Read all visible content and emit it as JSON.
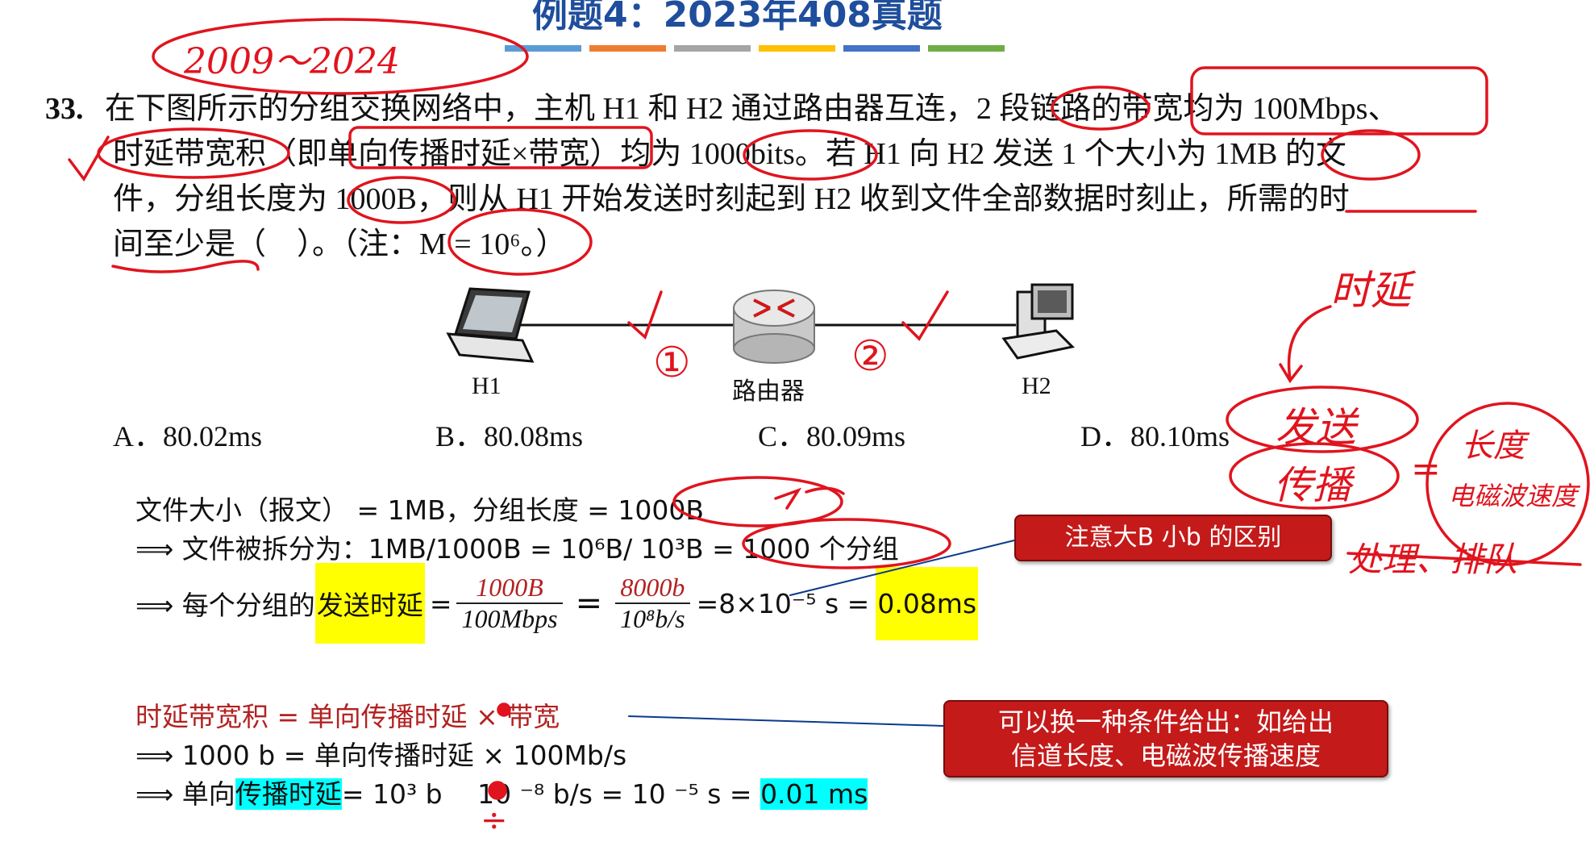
{
  "header": {
    "title": "例题4：2023年408真题",
    "bar_colors": [
      "#5b9bd5",
      "#ed7d31",
      "#a5a5a5",
      "#ffc000",
      "#4472c4",
      "#70ad47"
    ]
  },
  "question": {
    "number": "33.",
    "line1": "在下图所示的分组交换网络中，主机 H1 和 H2 通过路由器互连，2 段链路的带宽均为 100Mbps、",
    "line2": "时延带宽积（即单向传播时延×带宽）均为 1000bits。若 H1 向 H2 发送 1 个大小为 1MB 的文",
    "line3": "件，分组长度为 1000B，则从 H1 开始发送时刻起到 H2 收到文件全部数据时刻止，所需的时",
    "line4": "间至少是（　）。（注：M = 10⁶。）"
  },
  "diagram": {
    "h1": "H1",
    "router": "路由器",
    "h2": "H2"
  },
  "options": [
    {
      "label": "A．80.02ms"
    },
    {
      "label": "B．80.08ms"
    },
    {
      "label": "C．80.09ms"
    },
    {
      "label": "D．80.10ms"
    }
  ],
  "calc": {
    "l1": "文件大小（报文） = 1MB，分组长度 = 1000B",
    "l2": "⟹ 文件被拆分为：1MB/1000B = 10⁶B/ 10³B = 1000 个分组",
    "l3_prefix": "⟹ 每个分组的",
    "l3_highlight": "发送时延",
    "frac1_num": "1000B",
    "frac1_den": "100Mbps",
    "frac2_num": "8000b",
    "frac2_den": "10⁸b/s",
    "l3_result": "=8×10⁻⁵ s =",
    "l3_result_hl": "0.08ms",
    "l4": "时延带宽积 = 单向传播时延 × 带宽",
    "l5": "⟹ 1000 b = 单向传播时延 × 100Mb/s",
    "l6_prefix": "⟹ 单向",
    "l6_highlight": "传播时延",
    "l6_mid": "= 10³ b　 10 ⁻⁸ b/s = 10 ⁻⁵ s =",
    "l6_result_hl": "0.01 ms"
  },
  "callouts": {
    "c1": "注意大B 小b 的区别",
    "c2_line1": "可以换一种条件给出：如给出",
    "c2_line2": "信道长度、电磁波传播速度"
  },
  "handwriting": {
    "years": "2009～2024",
    "one": "①",
    "two": "②",
    "delay": "时延",
    "send": "发送",
    "prop": "传播",
    "eq": "=",
    "length": "长度",
    "speed": "电磁波速度",
    "proc": "处理、排队",
    "div": "÷"
  },
  "colors": {
    "ink_red": "#e0141e",
    "callout_red": "#c41a1a",
    "title_blue": "#1f4e9c"
  }
}
